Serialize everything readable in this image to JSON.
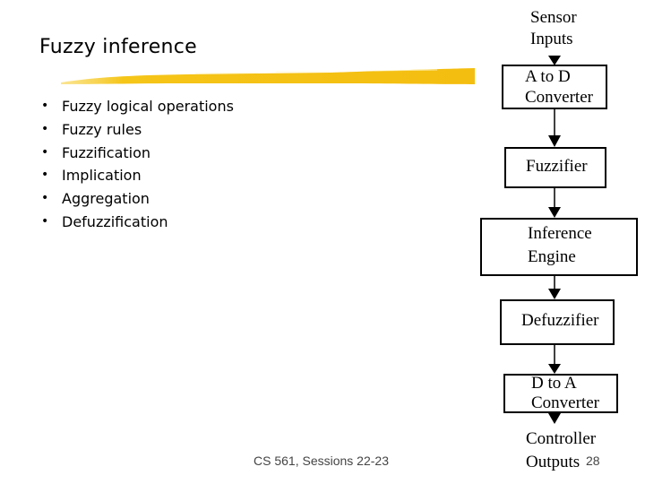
{
  "slide": {
    "title": "Fuzzy inference",
    "bullets": [
      "Fuzzy logical operations",
      "Fuzzy rules",
      "Fuzzification",
      "Implication",
      "Aggregation",
      "Defuzzification"
    ],
    "bullet_glyph": "•",
    "footer": "CS 561,  Sessions 22-23",
    "page_number": "28",
    "accent_color": "#f5c518"
  },
  "diagram": {
    "input_label": [
      "Sensor",
      "Inputs"
    ],
    "blocks": [
      {
        "line1": "A to D",
        "line2": "Converter"
      },
      {
        "line1": "Fuzzifier",
        "line2": ""
      },
      {
        "line1": "Inference",
        "line2": "Engine"
      },
      {
        "line1": "Defuzzifier",
        "line2": ""
      },
      {
        "line1": "D to A",
        "line2": "Converter"
      }
    ],
    "output_label": [
      "Controller",
      "Outputs"
    ]
  }
}
